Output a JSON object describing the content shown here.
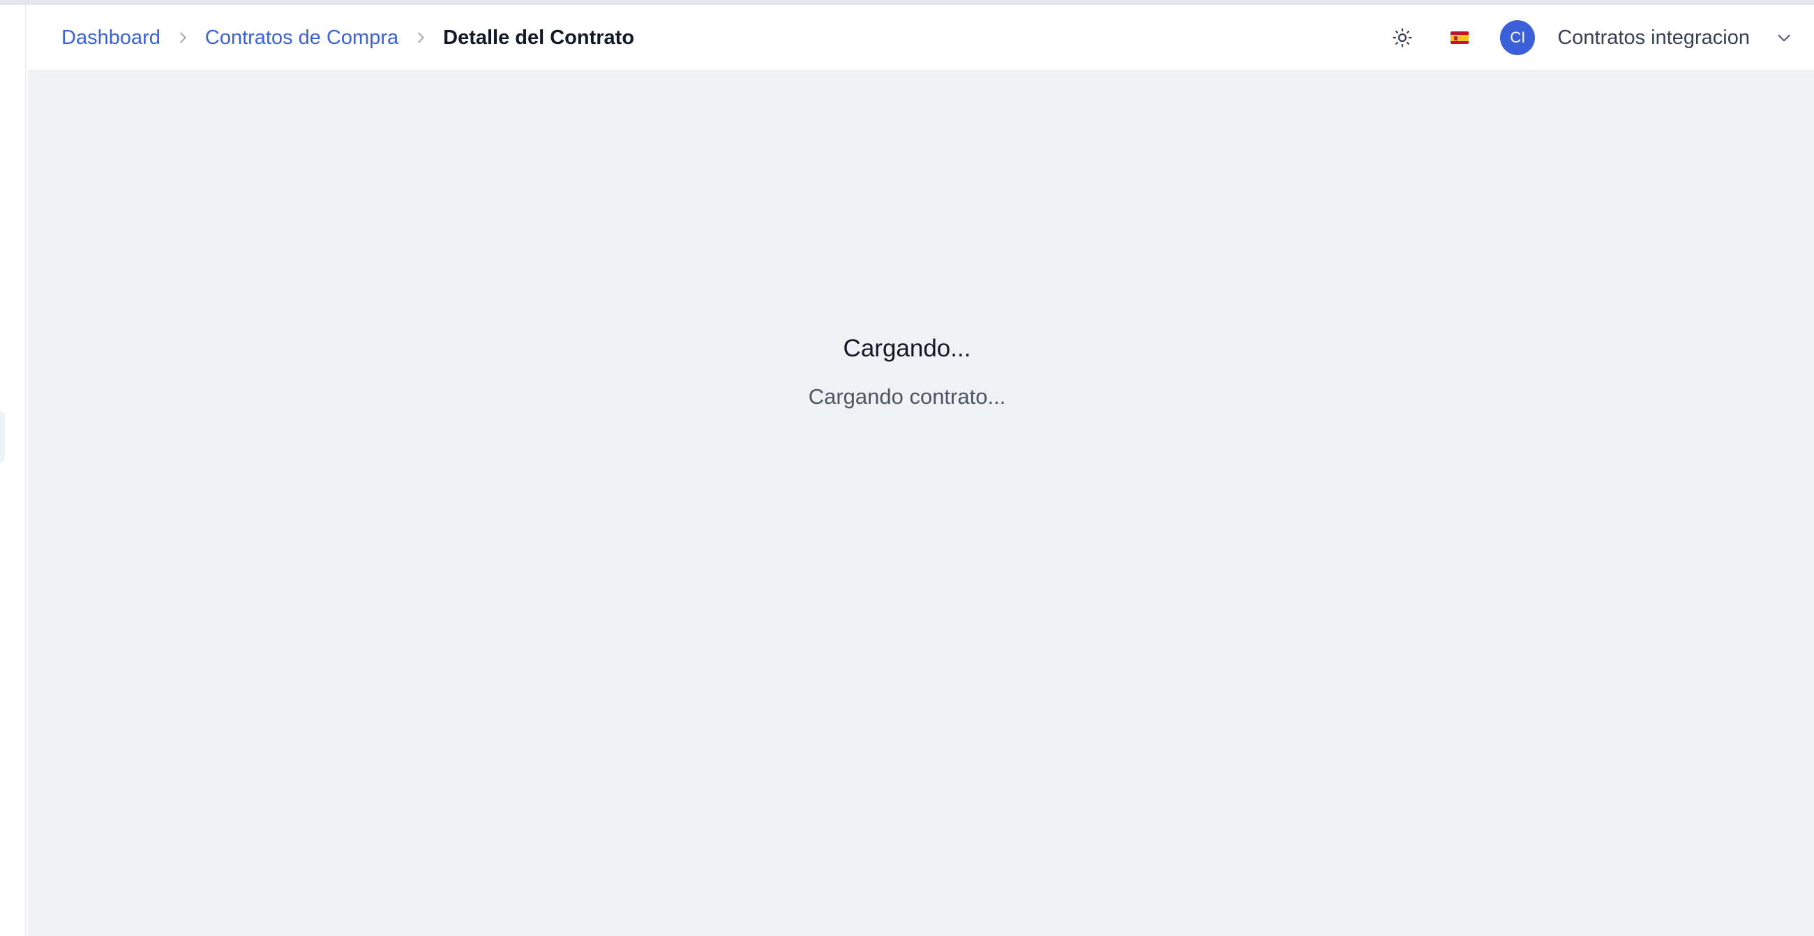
{
  "breadcrumb": {
    "items": [
      {
        "label": "Dashboard"
      },
      {
        "label": "Contratos de Compra"
      }
    ],
    "current": "Detalle del Contrato"
  },
  "header": {
    "theme_icon": "sun-icon",
    "language": "es",
    "language_icon": "spain-flag-icon",
    "user": {
      "initials": "CI",
      "name": "Contratos integracion",
      "menu_icon": "chevron-down-icon"
    }
  },
  "loading": {
    "title": "Cargando...",
    "message": "Cargando contrato..."
  },
  "colors": {
    "accent": "#3a63d6",
    "avatar_bg": "#3a5fd8",
    "main_bg": "#f0f1f4",
    "text_primary": "#111827",
    "text_secondary": "#4b5563"
  }
}
